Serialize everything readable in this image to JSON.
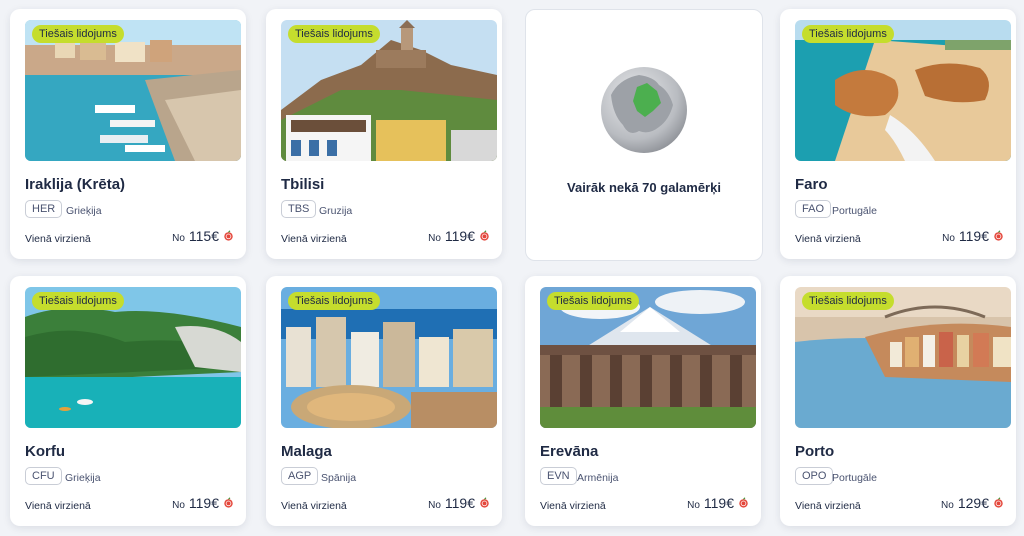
{
  "badge": "Tiešais lidojums",
  "oneway": "Vienā virzienā",
  "from": "No",
  "apple_icon": "apple-icon",
  "accent_color": "#c5dd2d",
  "cards": [
    {
      "city": "Iraklija (Krēta)",
      "code": "HER",
      "country": "Grieķija",
      "price": "115€"
    },
    {
      "city": "Tbilisi",
      "code": "TBS",
      "country": "Gruzija",
      "price": "119€"
    },
    {
      "city": "Faro",
      "code": "FAO",
      "country": "Portugāle",
      "price": "119€"
    },
    {
      "city": "Korfu",
      "code": "CFU",
      "country": "Grieķija",
      "price": "119€"
    },
    {
      "city": "Malaga",
      "code": "AGP",
      "country": "Spānija",
      "price": "119€"
    },
    {
      "city": "Erevāna",
      "code": "EVN",
      "country": "Armēnija",
      "price": "119€"
    },
    {
      "city": "Porto",
      "code": "OPO",
      "country": "Portugāle",
      "price": "129€"
    }
  ],
  "more_destinations": "Vairāk nekā 70 galamērķi"
}
